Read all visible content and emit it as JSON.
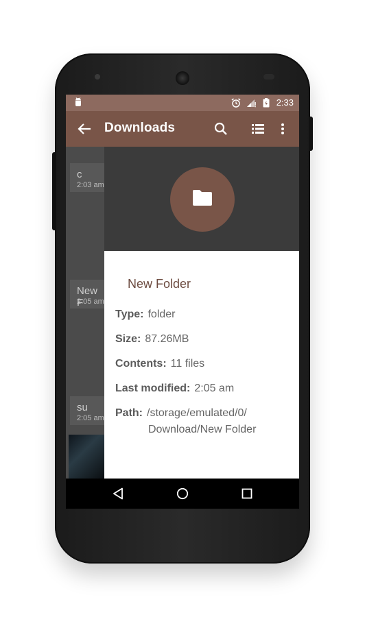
{
  "status_bar": {
    "time": "2:33",
    "left_icon": "android-debug-icon",
    "right_icons": [
      "alarm-icon",
      "signal-icon",
      "battery-charging-icon"
    ]
  },
  "app_bar": {
    "title": "Downloads",
    "actions": [
      "search-icon",
      "list-view-icon",
      "overflow-menu-icon"
    ]
  },
  "background_list": [
    {
      "name": "c",
      "time": "2:03 am"
    },
    {
      "name": "New F",
      "time": "2:05 am"
    },
    {
      "name": "su",
      "time": "2:05 am"
    }
  ],
  "details": {
    "folder_name": "New Folder",
    "type_label": "Type:",
    "type_value": "folder",
    "size_label": "Size:",
    "size_value": "87.26MB",
    "contents_label": "Contents:",
    "contents_value": "11 files",
    "modified_label": "Last modified:",
    "modified_value": "2:05 am",
    "path_label": "Path:",
    "path_value_line1": "/storage/emulated/0/",
    "path_value_line2": "Download/New Folder"
  },
  "colors": {
    "primary": "#795548",
    "primary_light": "#8d6a5f",
    "accent_text": "#6d4c41"
  }
}
